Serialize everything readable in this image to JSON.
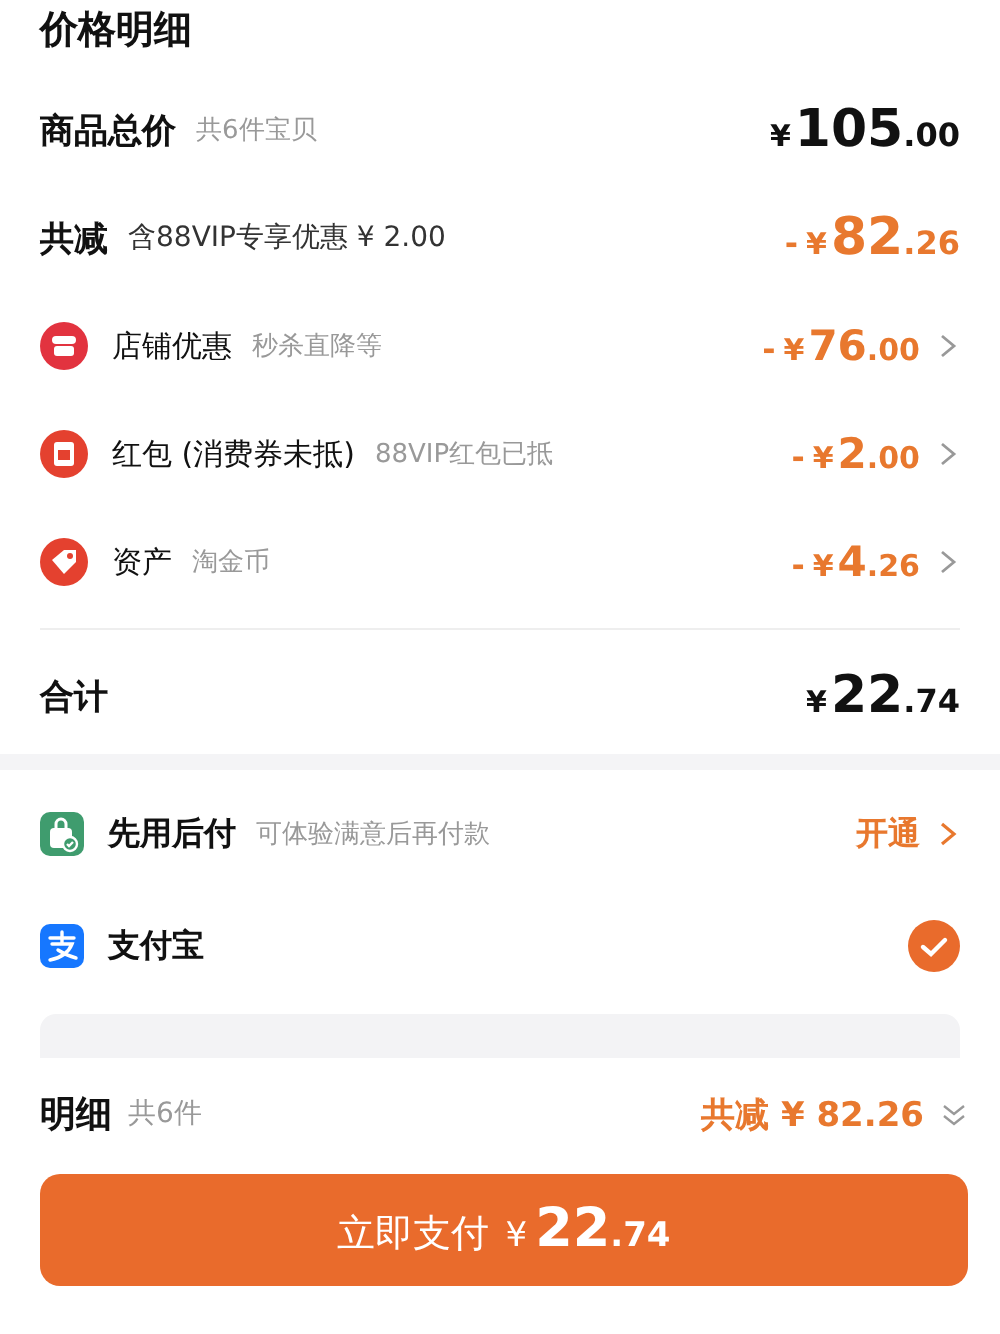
{
  "title": "价格明细",
  "summary": [
    {
      "kind": "total",
      "label": "商品总价",
      "note": "共6件宝贝",
      "currency": "¥",
      "int": "105",
      "dec": ".00"
    },
    {
      "kind": "discount",
      "label": "共减",
      "note": "含88VIP专享优惠 ¥ 2.00",
      "sign": "-",
      "currency": "¥",
      "int": "82",
      "dec": ".26"
    }
  ],
  "discounts": [
    {
      "label": "店铺优惠",
      "note": "秒杀直降等",
      "sign": "-",
      "currency": "¥",
      "int": "76",
      "dec": ".00"
    },
    {
      "label": "红包 (消费券未抵)",
      "note": "88VIP红包已抵",
      "sign": "-",
      "currency": "¥",
      "int": "2",
      "dec": ".00"
    },
    {
      "label": "资产",
      "note": "淘金币",
      "sign": "-",
      "currency": "¥",
      "int": "4",
      "dec": ".26"
    }
  ],
  "total": {
    "label": "合计",
    "currency": "¥",
    "int": "22",
    "dec": ".74"
  },
  "payments": [
    {
      "label": "先用后付",
      "note": "可体验满意后再付款",
      "action": "开通",
      "selected": false
    },
    {
      "label": "支付宝",
      "selected": true
    }
  ],
  "footer": {
    "label": "明细",
    "count": "共6件",
    "saving": "共减 ¥ 82.26"
  },
  "pay_button": {
    "label": "立即支付",
    "currency": "¥",
    "int": "22",
    "dec": ".74"
  }
}
